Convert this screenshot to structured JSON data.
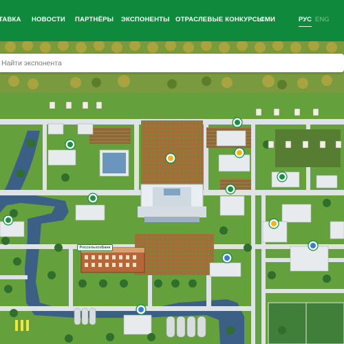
{
  "nav": {
    "items": [
      {
        "label": "ТАВКА"
      },
      {
        "label": "НОВОСТИ"
      },
      {
        "label": "ПАРТНЁРЫ"
      },
      {
        "label": "ЭКСПОНЕНТЫ"
      },
      {
        "label": "ОТРАСЛЕВЫЕ КОНКУРСЫ"
      },
      {
        "label": "СМИ"
      }
    ],
    "languages": [
      {
        "label": "РУС",
        "active": true
      },
      {
        "label": "ENG",
        "active": false
      }
    ]
  },
  "search": {
    "placeholder": "Найти экспонента",
    "value": ""
  },
  "map": {
    "bank_sign": "РоссельхозБанк"
  },
  "colors": {
    "header_green": "#0f8a3c",
    "grass": "#5e9a3b",
    "road": "#dfe3e6",
    "water": "#3c5f86"
  }
}
